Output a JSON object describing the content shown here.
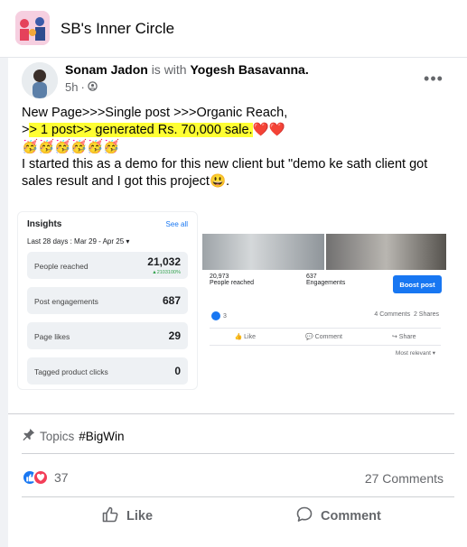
{
  "group": {
    "name": "SB's Inner Circle"
  },
  "post": {
    "author": "Sonam Jadon",
    "with_text": "is with",
    "tagged": "Yogesh Basavanna.",
    "time": "5h",
    "privacy_icon": "group-members-icon",
    "line1": "New Page>>>Single post >>>Organic Reach,",
    "line2_prefix": ">",
    "line2_highlight": "> 1 post>> generated Rs. 70,000 sale.",
    "line2_emoji": "❤️❤️",
    "line3_emoji": "🥳🥳🥳🥳🥳🥳",
    "line4": "I started this as a demo for this new client but \"demo ke sath client got sales result and I got this project",
    "line4_emoji": "😃."
  },
  "insights": {
    "title": "Insights",
    "see_all": "See all",
    "range": "Last 28 days : Mar 29 - Apr 25",
    "rows": [
      {
        "label": "People reached",
        "value": "21,032",
        "delta": "▲2103100%"
      },
      {
        "label": "Post engagements",
        "value": "687"
      },
      {
        "label": "Page likes",
        "value": "29"
      },
      {
        "label": "Tagged product clicks",
        "value": "0"
      }
    ]
  },
  "embed": {
    "reached_value": "20,973",
    "reached_label": "People reached",
    "engagements_value": "637",
    "engagements_label": "Engagements",
    "boost_label": "Boost post",
    "reactions": "3",
    "comments": "4 Comments",
    "shares": "2 Shares",
    "like": "Like",
    "comment": "Comment",
    "share": "Share",
    "most_relevant": "Most relevant ▾"
  },
  "topics": {
    "label": "Topics",
    "tag": "#BigWin"
  },
  "engagement": {
    "reactions_count": "37",
    "comments_count": "27 Comments"
  },
  "actions": {
    "like": "Like",
    "comment": "Comment"
  },
  "colors": {
    "accent": "#1877f2",
    "highlight": "#ffff33",
    "muted": "#65676b"
  }
}
